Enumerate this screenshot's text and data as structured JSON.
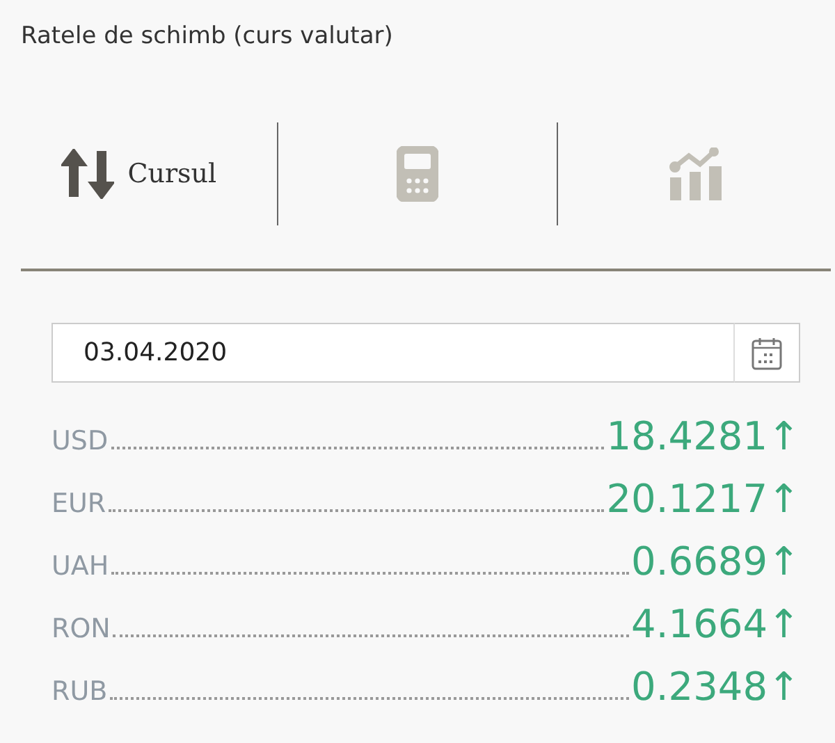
{
  "title": "Ratele de schimb (curs valutar)",
  "tabs": [
    {
      "kind": "exchange",
      "label": "Cursul",
      "selected": true
    },
    {
      "kind": "calculator",
      "selected": false
    },
    {
      "kind": "chart",
      "selected": false
    }
  ],
  "date_field": {
    "value": "03.04.2020"
  },
  "rates": [
    {
      "currency": "USD",
      "value": "18.4281",
      "trend": "↑"
    },
    {
      "currency": "EUR",
      "value": "20.1217",
      "trend": "↑"
    },
    {
      "currency": "UAH",
      "value": "0.6689",
      "trend": "↑"
    },
    {
      "currency": "RON",
      "value": "4.1664",
      "trend": "↑"
    },
    {
      "currency": "RUB",
      "value": "0.2348",
      "trend": "↑"
    }
  ]
}
